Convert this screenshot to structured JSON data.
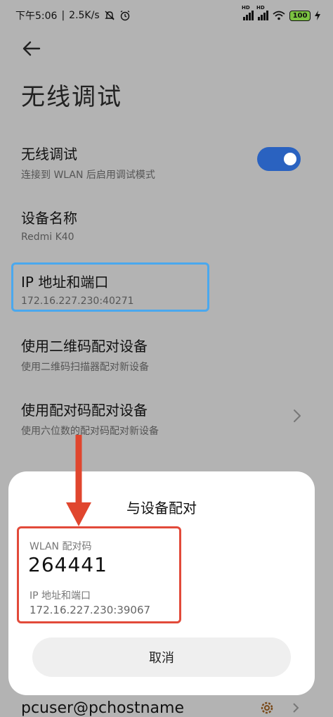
{
  "status": {
    "time": "下午5:06",
    "speed": "2.5K/s",
    "battery": "100",
    "hd1": "HD",
    "hd2": "HD",
    "icons": [
      "mute-icon",
      "alarm-icon",
      "signal-icon",
      "wifi-icon",
      "battery-icon",
      "charging-icon"
    ]
  },
  "page": {
    "title": "无线调试"
  },
  "settings": {
    "wireless_debug": {
      "title": "无线调试",
      "subtitle": "连接到 WLAN 后启用调试模式",
      "enabled": true
    },
    "device_name": {
      "title": "设备名称",
      "value": "Redmi K40"
    },
    "ip_port": {
      "title": "IP 地址和端口",
      "value": "172.16.227.230:40271"
    },
    "qr_pair": {
      "title": "使用二维码配对设备",
      "subtitle": "使用二维码扫描器配对新设备"
    },
    "code_pair": {
      "title": "使用配对码配对设备",
      "subtitle": "使用六位数的配对码配对新设备"
    },
    "paired_device": {
      "name": "pcuser@pchostname"
    }
  },
  "dialog": {
    "title": "与设备配对",
    "code_label": "WLAN 配对码",
    "code": "264441",
    "ip_label": "IP 地址和端口",
    "ip_value": "172.16.227.230:39067",
    "cancel_label": "取消"
  },
  "colors": {
    "toggle_on": "#2a62c0",
    "highlight_blue": "#4aa8ee",
    "highlight_red": "#e24a3a",
    "battery_green": "#7cc242",
    "dim_background": "#b3b3b3"
  }
}
